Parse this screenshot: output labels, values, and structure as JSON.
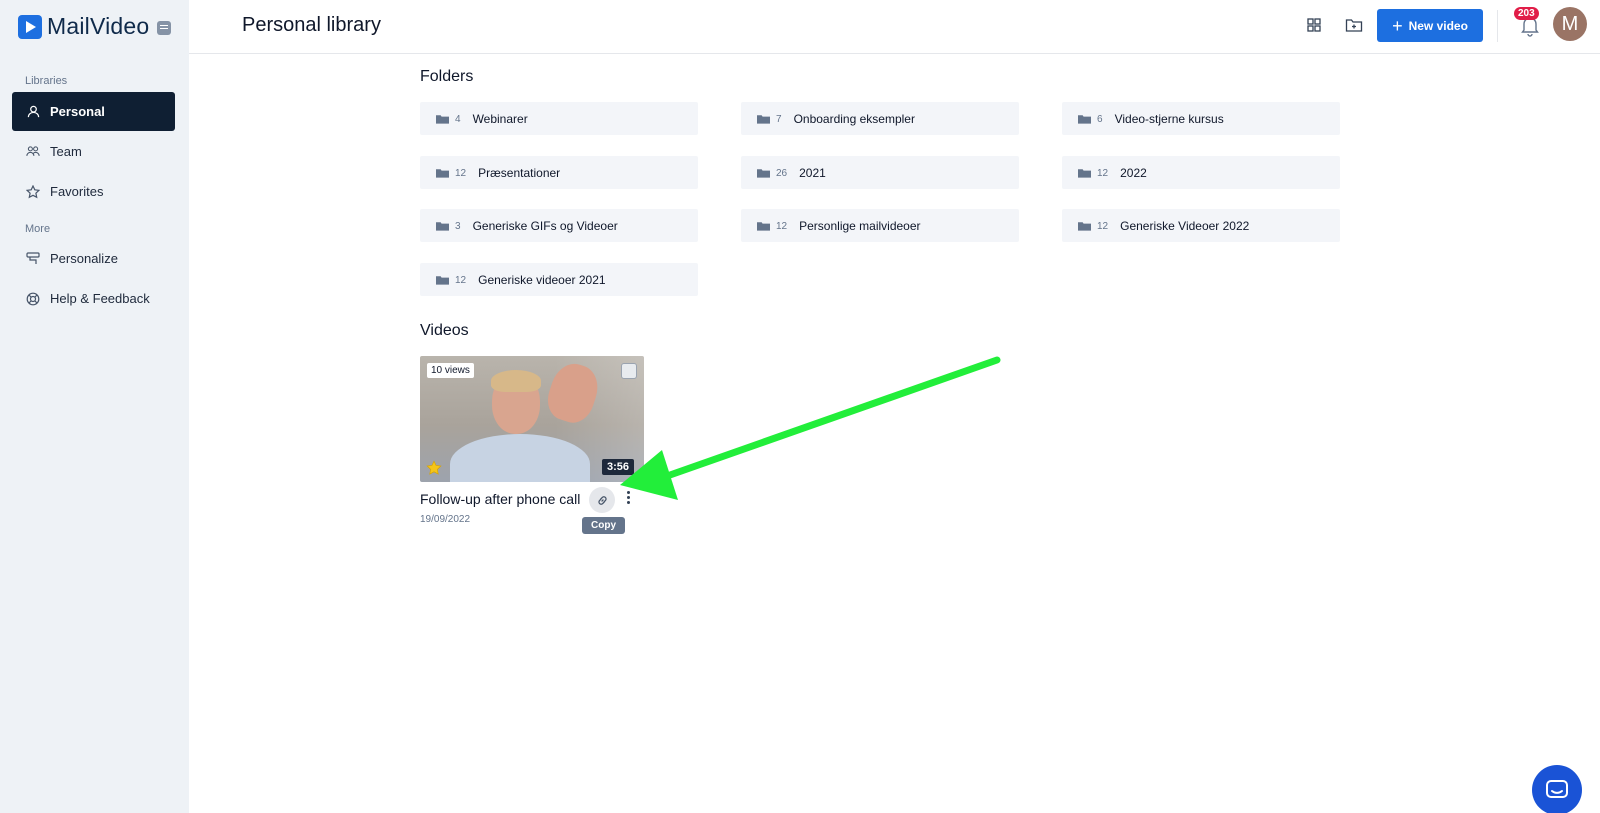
{
  "app": {
    "name": "MailVideo"
  },
  "sidebar": {
    "sections": [
      {
        "label": "Libraries"
      },
      {
        "label": "More"
      }
    ],
    "items": [
      {
        "label": "Personal",
        "icon": "user-icon",
        "active": true
      },
      {
        "label": "Team",
        "icon": "team-icon"
      },
      {
        "label": "Favorites",
        "icon": "star-icon"
      },
      {
        "label": "Personalize",
        "icon": "personalize-icon"
      },
      {
        "label": "Help & Feedback",
        "icon": "lifebuoy-icon"
      }
    ]
  },
  "header": {
    "title": "Personal library",
    "new_video_label": "New video",
    "notifications_count": "203",
    "avatar_initial": "M"
  },
  "folders_section": {
    "title": "Folders",
    "items": [
      {
        "count": "4",
        "name": "Webinarer"
      },
      {
        "count": "7",
        "name": "Onboarding eksempler"
      },
      {
        "count": "6",
        "name": "Video-stjerne kursus"
      },
      {
        "count": "12",
        "name": "Præsentationer"
      },
      {
        "count": "26",
        "name": "2021"
      },
      {
        "count": "12",
        "name": "2022"
      },
      {
        "count": "3",
        "name": "Generiske GIFs og Videoer"
      },
      {
        "count": "12",
        "name": "Personlige mailvideoer"
      },
      {
        "count": "12",
        "name": "Generiske Videoer 2022"
      },
      {
        "count": "12",
        "name": "Generiske videoer 2021"
      }
    ]
  },
  "videos_section": {
    "title": "Videos",
    "items": [
      {
        "title": "Follow-up after phone call",
        "views": "10 views",
        "duration": "3:56",
        "date": "19/09/2022",
        "favorite": true,
        "tooltip": "Copy"
      }
    ]
  },
  "colors": {
    "primary": "#1d6fe0",
    "sidebar_bg": "#eef2f6",
    "active_nav": "#0f1f33",
    "badge": "#e11d48",
    "annotation_arrow": "#22ee3a"
  }
}
